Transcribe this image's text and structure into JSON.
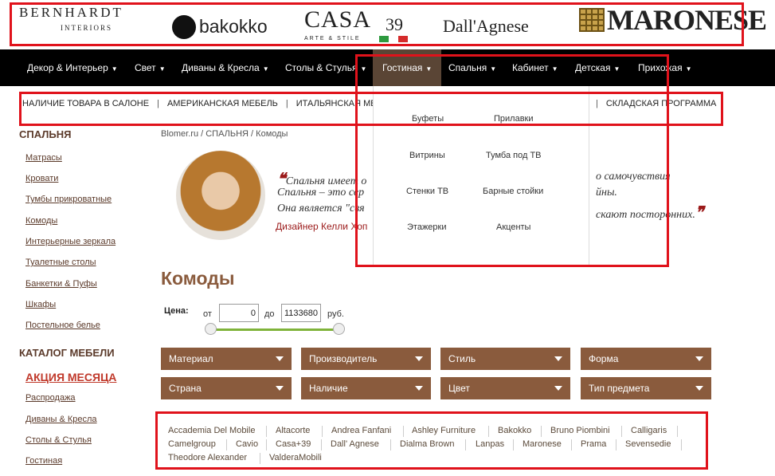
{
  "brands": {
    "bernhardt": "BERNHARDT",
    "bernhardt_sub": "INTERIORS",
    "bakokko": "bakokko",
    "casa": "CASA",
    "casa_num": "39",
    "casa_sub": "ARTE & STILE",
    "dallagnese": "Dall'Agnese",
    "maronese": "MARONESE"
  },
  "nav": {
    "items": [
      "Декор & Интерьер",
      "Свет",
      "Диваны & Кресла",
      "Столы & Стулья",
      "Гостиная",
      "Спальня",
      "Кабинет",
      "Детская",
      "Прихожая"
    ],
    "active": "Гостиная"
  },
  "subnav": {
    "items": [
      "НАЛИЧИЕ ТОВАРА В САЛОНЕ",
      "АМЕРИКАНСКАЯ МЕБЕЛЬ",
      "ИТАЛЬЯНСКАЯ МЕБЕЛЬ",
      "СКЛАДСКАЯ ПРОГРАММА"
    ]
  },
  "dropdown": {
    "items": [
      "Буфеты",
      "Прилавки",
      "Витрины",
      "Тумба под ТВ",
      "Стенки ТВ",
      "Барные стойки",
      "Этажерки",
      "Акценты"
    ]
  },
  "sidebar": {
    "heading1": "СПАЛЬНЯ",
    "links1": [
      "Матрасы",
      "Кровати",
      "Тумбы прикроватные",
      "Комоды",
      "Интерьерные зеркала",
      "Туалетные столы",
      "Банкетки & Пуфы",
      "Шкафы",
      "Постельное белье"
    ],
    "heading2": "КАТАЛОГ МЕБЕЛИ",
    "promo": "АКЦИЯ МЕСЯЦА",
    "links2": [
      "Распродажа",
      "Диваны & Кресла",
      "Столы & Стулья",
      "Гостиная"
    ]
  },
  "breadcrumb": "Blomer.ru / СПАЛЬНЯ / Комоды",
  "quote": {
    "line1": "Спальня имеет о",
    "line1_end": "о самочувствия",
    "line2": "Спальня – это сер",
    "line2_end": "йны.",
    "line3": "Она является \"свя",
    "line3_end": "скают посторонних.",
    "author": "Дизайнер Келли Хоп"
  },
  "page_title": "Комоды",
  "price": {
    "label": "Цена:",
    "from_label": "от",
    "from_value": "0",
    "to_label": "до",
    "to_value": "1133680",
    "currency": "руб."
  },
  "filters": [
    "Материал",
    "Производитель",
    "Стиль",
    "Форма",
    "Страна",
    "Наличие",
    "Цвет",
    "Тип предмета"
  ],
  "makers": {
    "row1": [
      "Accademia Del Mobile",
      "Altacorte",
      "Andrea Fanfani",
      "Ashley Furniture",
      "Bakokko",
      "Bruno Piombini",
      "Calligaris"
    ],
    "row2": [
      "Camelgroup",
      "Cavio",
      "Casa+39",
      "Dall' Agnese",
      "Dialma Brown",
      "Lanpas",
      "Maronese",
      "Prama",
      "Sevensedie"
    ],
    "row3": [
      "Theodore Alexander",
      "ValderaMobili"
    ]
  },
  "colors": {
    "accent_brown": "#8a5b3d",
    "nav_bg": "#000000",
    "highlight_red": "#e0121b"
  }
}
